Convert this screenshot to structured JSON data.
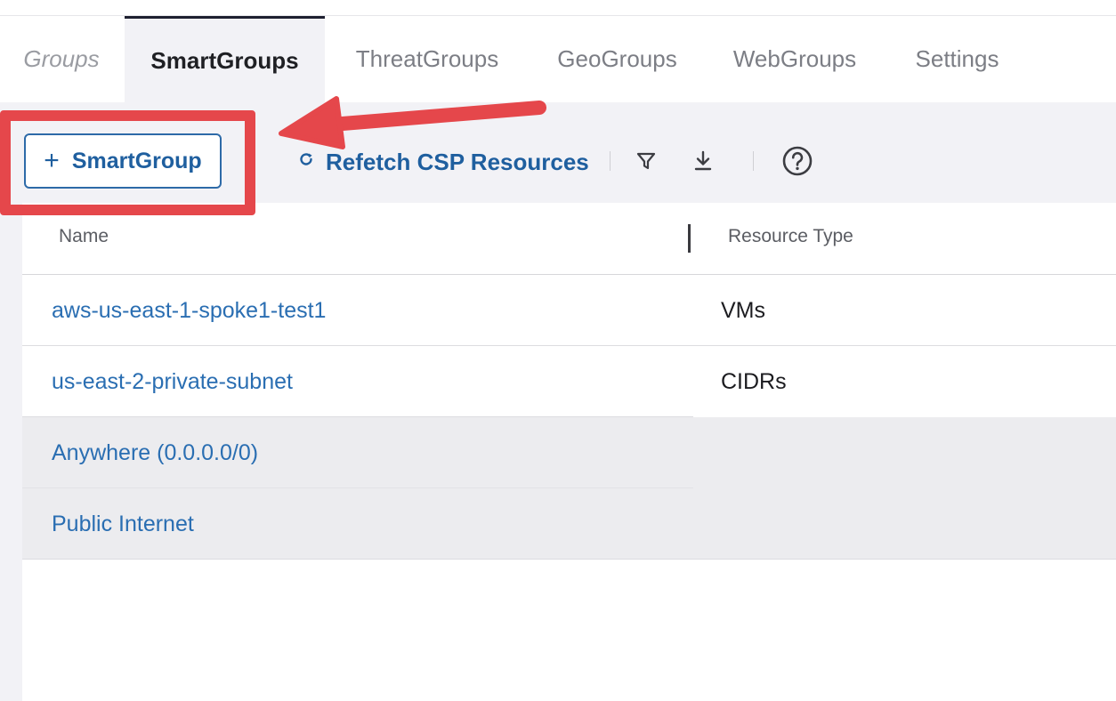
{
  "tabs": [
    {
      "label": "Groups"
    },
    {
      "label": "SmartGroups"
    },
    {
      "label": "ThreatGroups"
    },
    {
      "label": "GeoGroups"
    },
    {
      "label": "WebGroups"
    },
    {
      "label": "Settings"
    }
  ],
  "active_tab": "SmartGroups",
  "toolbar": {
    "add_label": "SmartGroup",
    "add_icon": "plus-icon",
    "refetch_label": "Refetch CSP Resources",
    "refetch_icon": "refresh-icon",
    "filter_icon": "filter-icon",
    "download_icon": "download-icon",
    "help_icon": "help-circle-icon"
  },
  "table": {
    "columns": [
      "Name",
      "Resource Type"
    ],
    "rows": [
      {
        "name": "aws-us-east-1-spoke1-test1",
        "type": "VMs"
      },
      {
        "name": "us-east-2-private-subnet",
        "type": "CIDRs"
      },
      {
        "name": "Anywhere (0.0.0.0/0)",
        "type": ""
      },
      {
        "name": "Public Internet",
        "type": ""
      }
    ]
  },
  "colors": {
    "accent": "#2a6eb2",
    "annotation": "#e5474b",
    "workspace": "#f2f2f6"
  }
}
